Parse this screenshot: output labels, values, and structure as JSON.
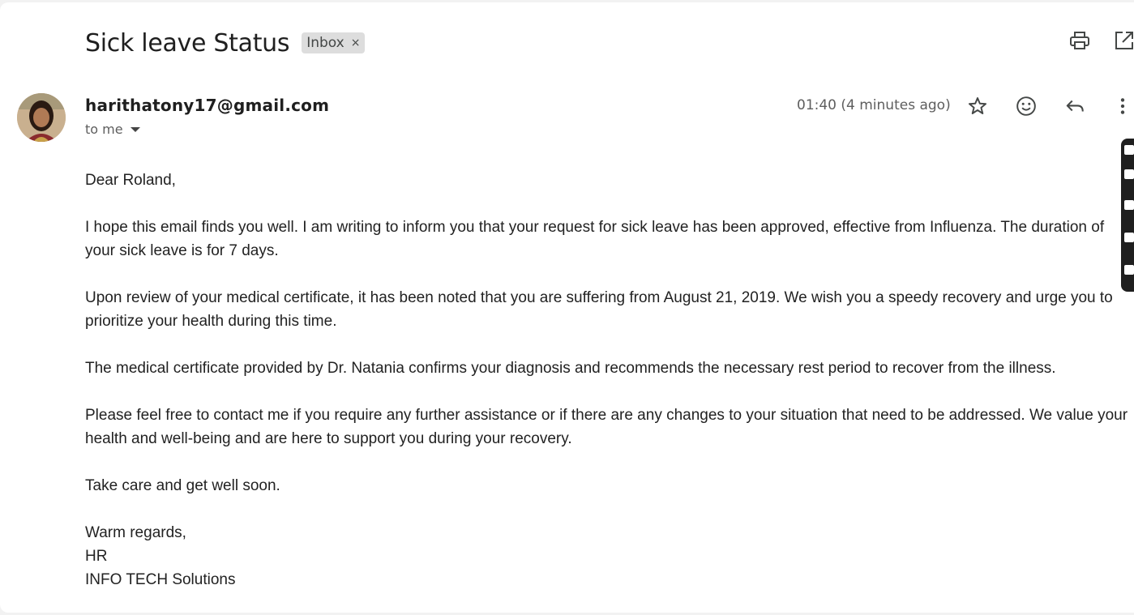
{
  "email": {
    "subject": "Sick leave Status",
    "label_chip": "Inbox",
    "label_remove_glyph": "×",
    "sender_email": "harithatony17@gmail.com",
    "recipient_line": "to me",
    "timestamp": "01:40 (4 minutes ago)",
    "body_paragraphs": [
      "Dear Roland,",
      "I hope this email finds you well. I am writing to inform you that your request for sick leave has been approved, effective from Influenza. The duration of your sick leave is for 7 days.",
      "Upon review of your medical certificate, it has been noted that you are suffering from August 21, 2019. We wish you a speedy recovery and urge you to prioritize your health during this time.",
      "The medical certificate provided by Dr. Natania confirms your diagnosis and recommends the necessary rest period to recover from the illness.",
      "Please feel free to contact me if you require any further assistance or if there are any changes to your situation that need to be addressed. We value your health and well-being and are here to support you during your recovery.",
      "Take care and get well soon."
    ],
    "signature": [
      "Warm regards,",
      "HR",
      "INFO TECH Solutions"
    ]
  },
  "icons": {
    "print": "print-icon",
    "open_new_window": "open-in-new-window-icon",
    "star": "star-icon",
    "emoji": "emoji-reaction-icon",
    "reply": "reply-icon",
    "more": "more-vert-icon",
    "caret": "chevron-down-icon"
  },
  "colors": {
    "text_primary": "#1f1f1f",
    "text_secondary": "#5e5e5e",
    "chip_bg": "#dddddd",
    "side_panel": "#1f1f1f"
  }
}
